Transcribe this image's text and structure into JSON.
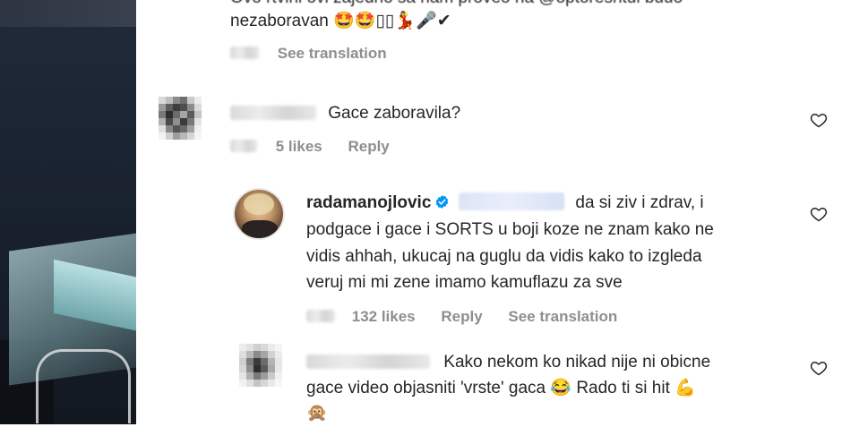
{
  "comment0": {
    "line1": "Ovo rtvini ovi zajedno sa nam proveo na @optoreshtul buuo",
    "line2_text": "nezaboravan",
    "line2_emoji": "🤩🤩▯▯💃🎤✔",
    "see_translation": "See translation"
  },
  "comment1": {
    "text": "Gace zaboravila?",
    "likes": "5 likes",
    "reply": "Reply"
  },
  "comment2": {
    "username": "radamanojlovic",
    "line1": "da si ziv i zdrav, i",
    "line2": "podgace i gace i SORTS u boji koze ne znam kako ne",
    "line3": "vidis ahhah, ukucaj na guglu da vidis kako to izgleda",
    "line4": "veruj mi mi zene imamo kamuflazu za sve",
    "likes": "132 likes",
    "reply": "Reply",
    "see_translation": "See translation"
  },
  "comment3": {
    "line1": "Kako nekom ko nikad nije ni obicne",
    "line2a": "gace video objasniti 'vrste' gaca",
    "emoji_laugh": "😂",
    "line2b": "Rado ti si hit",
    "emoji_muscle": "💪",
    "line3": "🙊"
  },
  "icons": {
    "heart": "heart-outline-icon",
    "verified": "verified-badge-icon"
  },
  "colors": {
    "text": "#262626",
    "meta": "#8e8e8e",
    "verified": "#0095f6"
  }
}
